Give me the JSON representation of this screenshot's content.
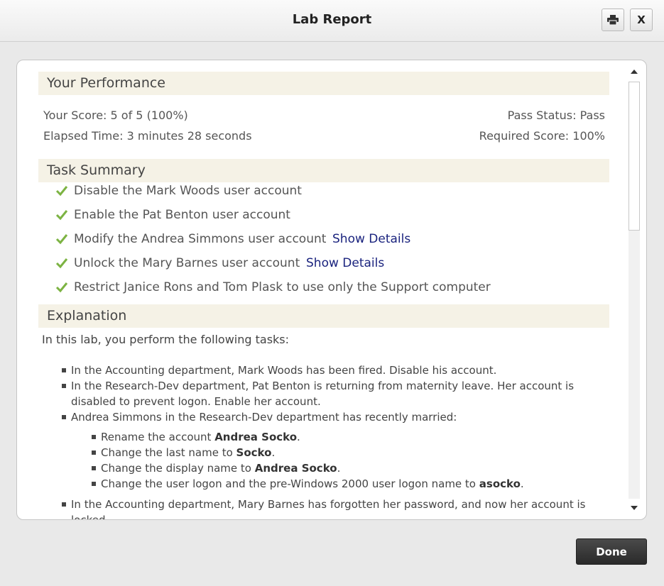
{
  "window": {
    "title": "Lab Report",
    "close_label": "X"
  },
  "performance": {
    "header": "Your Performance",
    "score": "Your Score: 5 of 5 (100%)",
    "elapsed": "Elapsed Time: 3 minutes 28 seconds",
    "pass_status": "Pass Status: Pass",
    "required_score": "Required Score: 100%"
  },
  "tasks": {
    "header": "Task Summary",
    "items": [
      {
        "label": "Disable the Mark Woods user account"
      },
      {
        "label": "Enable the Pat Benton user account"
      },
      {
        "label": "Modify the Andrea Simmons user account",
        "details": "Show Details"
      },
      {
        "label": "Unlock the Mary Barnes user account",
        "details": "Show Details"
      },
      {
        "label": "Restrict Janice Rons and Tom Plask to use only the Support computer"
      }
    ]
  },
  "explanation": {
    "header": "Explanation",
    "intro": "In this lab, you perform the following tasks:",
    "b1": "In the Accounting department, Mark Woods  has been fired. Disable his account.",
    "b2_line1": "In the Research-Dev department, Pat Benton is returning from maternity leave. Her account is",
    "b2_line2": "disabled to prevent logon. Enable her account.",
    "b3": "Andrea Simmons in the Research-Dev department has recently married:",
    "sub1_text": "Rename the account ",
    "sub1_bold": "Andrea Socko",
    "sub2_text": "Change the last name to ",
    "sub2_bold": "Socko",
    "sub3_text": "Change the display name to ",
    "sub3_bold": "Andrea Socko",
    "sub4_text": "Change the user logon and the pre-Windows 2000 user logon name to ",
    "sub4_bold": "asocko",
    "period": ".",
    "b4_line1": "In the Accounting department, Mary Barnes  has forgotten her password, and now her account is",
    "b4_line2": "locked"
  },
  "buttons": {
    "done": "Done"
  },
  "colors": {
    "check": "#7cb342",
    "link": "#1a237e",
    "header_bg": "#f5f2e6"
  }
}
